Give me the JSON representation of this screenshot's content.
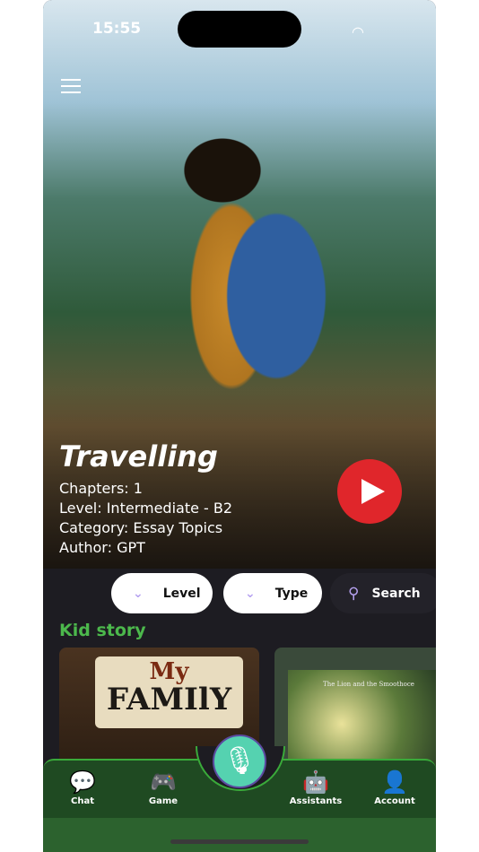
{
  "status": {
    "time": "15:55"
  },
  "hero": {
    "title": "Travelling",
    "chapters": "Chapters: 1",
    "level": "Level: Intermediate - B2",
    "category": "Category: Essay Topics",
    "author": "Author: GPT"
  },
  "filters": {
    "level": "Level",
    "type": "Type",
    "search": "Search"
  },
  "section": {
    "title": "Kid story",
    "cards": [
      {
        "title_top": "My",
        "title_bottom": "FAMIlY"
      },
      {
        "title": "The Lion and the Smoothoce"
      }
    ]
  },
  "nav": {
    "items": [
      {
        "label": "Chat",
        "icon": "chat-bubbles-icon"
      },
      {
        "label": "Game",
        "icon": "gamepad-icon"
      },
      {
        "label": "Assistants",
        "icon": "robot-icon"
      },
      {
        "label": "Account",
        "icon": "person-icon"
      }
    ],
    "center_icon": "microphone-icon"
  },
  "colors": {
    "accent_green": "#4cb84c",
    "nav_bg": "#1f4a22",
    "play": "#e0262b",
    "mic": "#55d2b0"
  }
}
